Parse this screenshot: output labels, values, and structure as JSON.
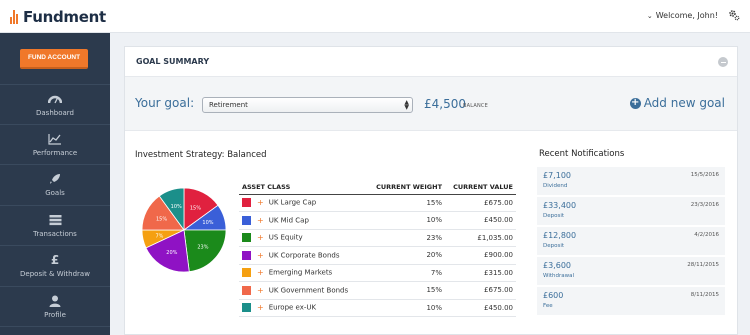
{
  "app": {
    "logo_text": "Fundment",
    "welcome_text": "Welcome, John!"
  },
  "sidebar": {
    "fund_button": "FUND ACCOUNT",
    "items": [
      {
        "label": "Dashboard",
        "icon": "dashboard-gauge-icon"
      },
      {
        "label": "Performance",
        "icon": "line-chart-icon"
      },
      {
        "label": "Goals",
        "icon": "rocket-icon"
      },
      {
        "label": "Transactions",
        "icon": "server-icon"
      },
      {
        "label": "Deposit & Withdraw",
        "icon": "pound-icon"
      },
      {
        "label": "Profile",
        "icon": "user-icon"
      }
    ]
  },
  "panel": {
    "title": "GOAL SUMMARY",
    "goal_label": "Your goal:",
    "goal_selected": "Retirement",
    "balance": "£4,500",
    "balance_label": "BALANCE",
    "add_goal": "Add new goal"
  },
  "strategy": {
    "title": "Investment Strategy: Balanced",
    "columns": [
      "ASSET CLASS",
      "CURRENT WEIGHT",
      "CURRENT VALUE"
    ],
    "rows": [
      {
        "name": "UK Large Cap",
        "weight": "15%",
        "value": "£675.00",
        "color": "#e0213f"
      },
      {
        "name": "UK Mid Cap",
        "weight": "10%",
        "value": "£450.00",
        "color": "#3a5fd8"
      },
      {
        "name": "US Equity",
        "weight": "23%",
        "value": "£1,035.00",
        "color": "#1b8a1b"
      },
      {
        "name": "UK Corporate Bonds",
        "weight": "20%",
        "value": "£900.00",
        "color": "#8f12c4"
      },
      {
        "name": "Emerging Markets",
        "weight": "7%",
        "value": "£315.00",
        "color": "#f5a011"
      },
      {
        "name": "UK Government Bonds",
        "weight": "15%",
        "value": "£675.00",
        "color": "#f0684a"
      },
      {
        "name": "Europe ex-UK",
        "weight": "10%",
        "value": "£450.00",
        "color": "#1b8f8a"
      }
    ]
  },
  "chart_data": {
    "type": "pie",
    "categories": [
      "UK Large Cap",
      "UK Mid Cap",
      "US Equity",
      "UK Corporate Bonds",
      "Emerging Markets",
      "UK Government Bonds",
      "Europe ex-UK"
    ],
    "values": [
      15,
      10,
      23,
      20,
      7,
      15,
      10
    ],
    "labels": [
      "15%",
      "10%",
      "23%",
      "20%",
      "7%",
      "15%",
      "10%"
    ],
    "colors": [
      "#e0213f",
      "#3a5fd8",
      "#1b8a1b",
      "#8f12c4",
      "#f5a011",
      "#f0684a",
      "#1b8f8a"
    ]
  },
  "notifications": {
    "title": "Recent Notifications",
    "items": [
      {
        "amount": "£7,100",
        "type": "Dividend",
        "date": "15/5/2016"
      },
      {
        "amount": "£33,400",
        "type": "Deposit",
        "date": "23/3/2016"
      },
      {
        "amount": "£12,800",
        "type": "Deposit",
        "date": "4/2/2016"
      },
      {
        "amount": "£3,600",
        "type": "Withdrawal",
        "date": "28/11/2015"
      },
      {
        "amount": "£600",
        "type": "Fee",
        "date": "8/11/2015"
      }
    ]
  }
}
